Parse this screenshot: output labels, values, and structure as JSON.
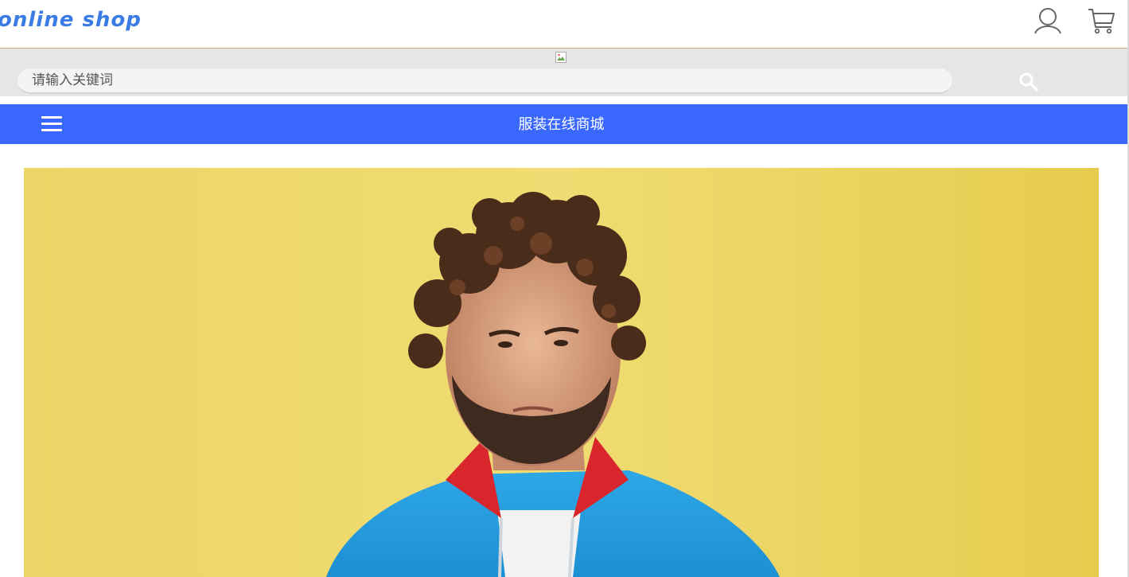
{
  "header": {
    "logo_text": "online shop",
    "user_icon": "user-icon",
    "cart_icon": "cart-icon"
  },
  "search": {
    "placeholder": "请输入关键词",
    "button_icon": "search-icon",
    "broken_image_icon": "broken-image-icon"
  },
  "nav": {
    "menu_icon": "hamburger-menu-icon",
    "title": "服装在线商城"
  },
  "colors": {
    "brand_blue": "#3a68ff",
    "logo_blue": "#3a7be6",
    "search_band": "#e6e6e6",
    "banner_yellow": "#ecd565"
  }
}
